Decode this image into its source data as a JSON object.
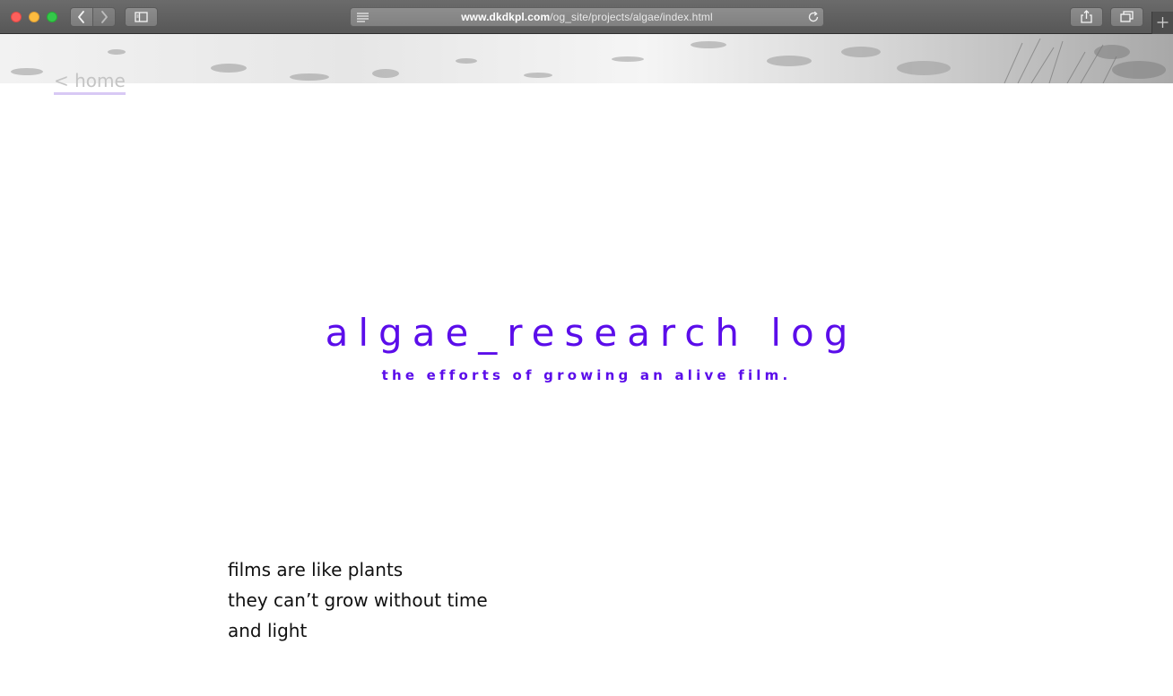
{
  "browser": {
    "url_domain": "www.dkdkpl.com",
    "url_path": "/og_site/projects/algae/index.html",
    "icons": {
      "back": "chevron-left-icon",
      "forward": "chevron-right-icon",
      "sidebar": "sidebar-icon",
      "reader": "reader-icon",
      "reload": "reload-icon",
      "share": "share-icon",
      "tabs": "tabs-overview-icon",
      "new_tab": "plus-icon"
    },
    "colors": {
      "close": "#fc605c",
      "minimize": "#fdbc40",
      "maximize": "#34c84a"
    }
  },
  "page": {
    "home_link": "< home",
    "title": "algae_research log",
    "subtitle": "the efforts of growing an alive film.",
    "poem": [
      "films are like plants",
      "they can’t grow without time",
      "and light"
    ],
    "colors": {
      "accent": "#5b0dea",
      "home_link": "#c4c4c4",
      "home_underline": "#d8c9f4"
    }
  }
}
